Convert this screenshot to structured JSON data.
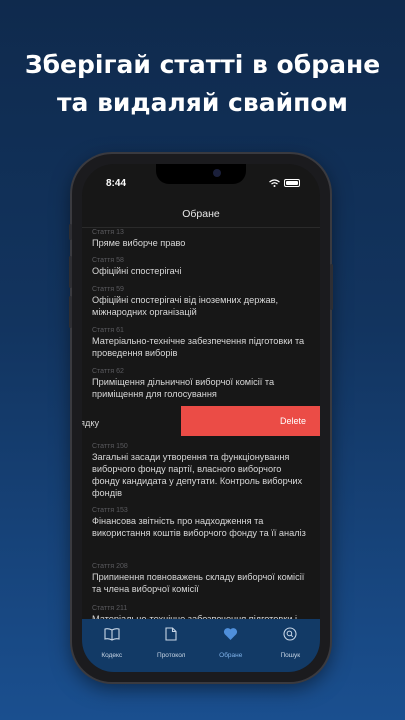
{
  "headline": {
    "line1": "Зберігай статті в обране",
    "line2": "та видаляй свайпом"
  },
  "status_bar": {
    "time": "8:44"
  },
  "nav": {
    "title": "Обране"
  },
  "articles": [
    {
      "number": "Стаття 13",
      "title": "Пряме виборче право"
    },
    {
      "number": "Стаття 58",
      "title": "Офіційні спостерігачі"
    },
    {
      "number": "Стаття 59",
      "title": "Офіційні спостерігачі від іноземних держав, міжнародних організацій"
    },
    {
      "number": "Стаття 61",
      "title": "Матеріально-технічне забезпечення підготовки та проведення виборів"
    },
    {
      "number": "Стаття 62",
      "title": "Приміщення дільничної виборчої комісії та приміщення для голосування"
    }
  ],
  "swiped_row": {
    "visible_text": "ядку",
    "delete_label": "Delete"
  },
  "articles_after": [
    {
      "number": "Стаття 150",
      "title": "Загальні засади утворення та функціонування виборчого фонду партії, власного виборчого фонду кандидата у депутати. Контроль виборчих фондів"
    },
    {
      "number": "Стаття 153",
      "title": "Фінансова звітність про надходження та використання коштів виборчого фонду та її аналіз"
    },
    {
      "number": "Стаття 208",
      "title": "Припинення повноважень складу виборчої комісії та члена виборчої комісії"
    },
    {
      "number": "Стаття 211",
      "title": "Матеріально-технічне забезпечення підготовки і"
    }
  ],
  "tabs": [
    {
      "label": "Кодекс",
      "icon": "book-icon"
    },
    {
      "label": "Протокол",
      "icon": "document-icon"
    },
    {
      "label": "Обране",
      "icon": "heart-icon",
      "active": true
    },
    {
      "label": "Пошук",
      "icon": "search-icon"
    }
  ],
  "colors": {
    "background_top": "#0f2a4d",
    "background_bottom": "#1a4f8f",
    "delete": "#eb4c46",
    "tab_active": "#4f8fdb",
    "tabbar": "#123a66"
  }
}
